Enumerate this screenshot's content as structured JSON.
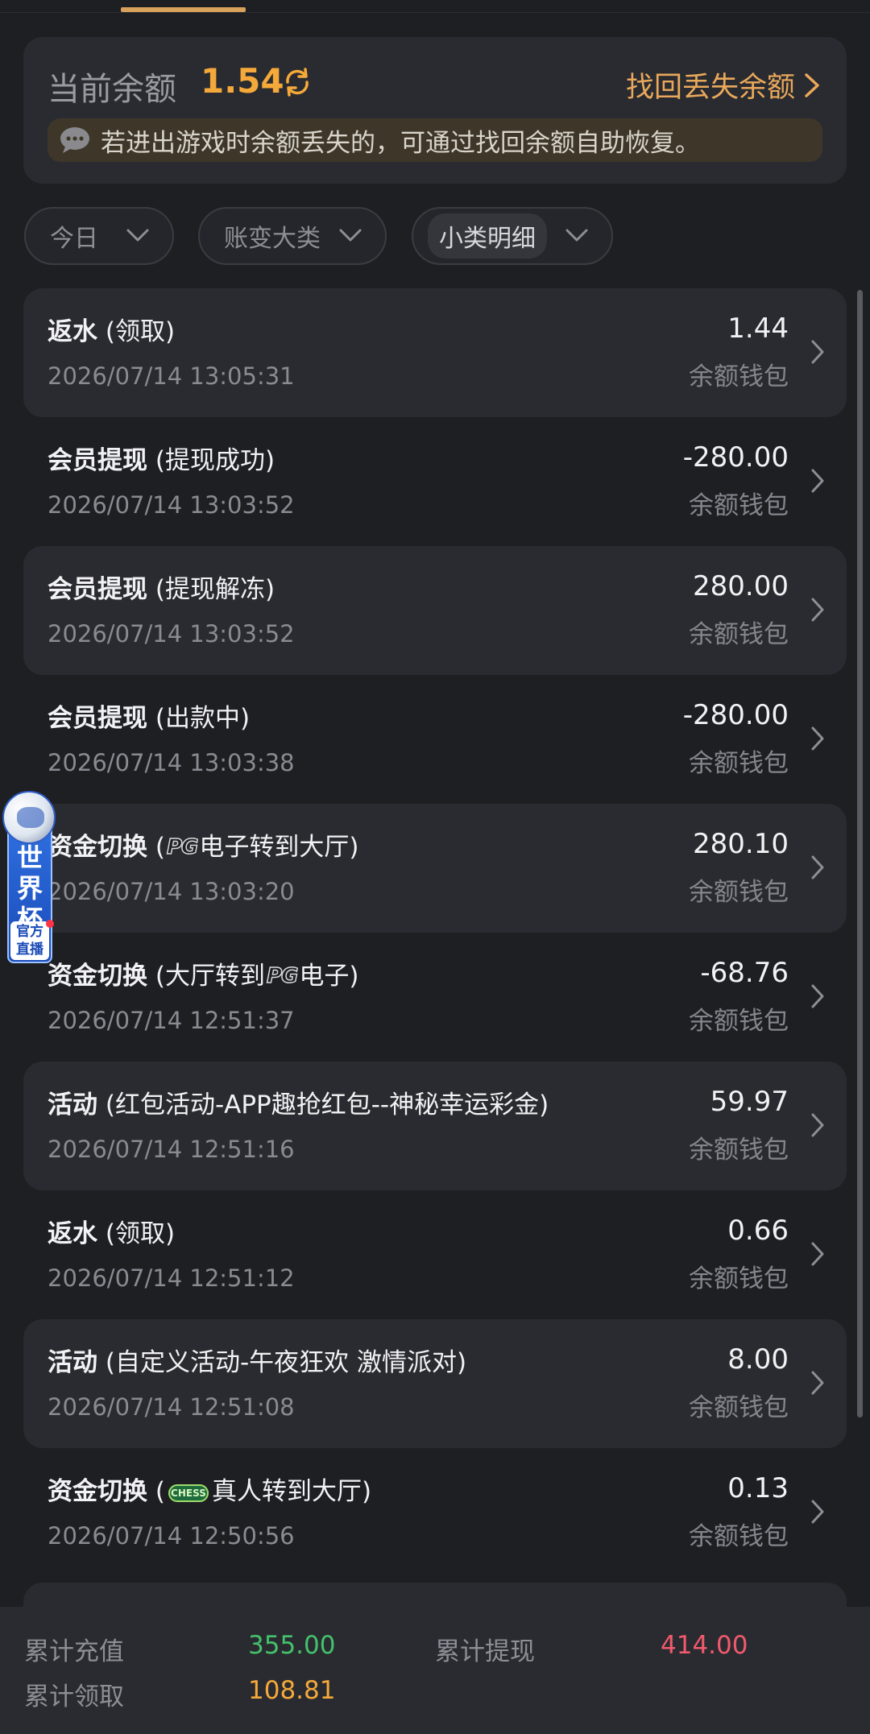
{
  "balance": {
    "label": "当前余额",
    "value": "1.54",
    "recover_label": "找回丢失余额",
    "tip": "若进出游戏时余额丢失的，可通过找回余额自助恢复。"
  },
  "filters": {
    "day": "今日",
    "category": "账变大类",
    "subcategory": "小类明细"
  },
  "records": [
    {
      "type": "返水",
      "detail_pre": " (领取)",
      "logo": "",
      "detail_post": "",
      "time": "2026/07/14 13:05:31",
      "amount": "1.44",
      "wallet": "余额钱包"
    },
    {
      "type": "会员提现",
      "detail_pre": " (提现成功)",
      "logo": "",
      "detail_post": "",
      "time": "2026/07/14 13:03:52",
      "amount": "-280.00",
      "wallet": "余额钱包"
    },
    {
      "type": "会员提现",
      "detail_pre": " (提现解冻)",
      "logo": "",
      "detail_post": "",
      "time": "2026/07/14 13:03:52",
      "amount": "280.00",
      "wallet": "余额钱包"
    },
    {
      "type": "会员提现",
      "detail_pre": " (出款中)",
      "logo": "",
      "detail_post": "",
      "time": "2026/07/14 13:03:38",
      "amount": "-280.00",
      "wallet": "余额钱包"
    },
    {
      "type": "资金切换",
      "detail_pre": " (",
      "logo": "PG",
      "detail_post": "电子转到大厅)",
      "time": "2026/07/14 13:03:20",
      "amount": "280.10",
      "wallet": "余额钱包"
    },
    {
      "type": "资金切换",
      "detail_pre": " (大厅转到",
      "logo": "PG",
      "detail_post": "电子)",
      "time": "2026/07/14 12:51:37",
      "amount": "-68.76",
      "wallet": "余额钱包"
    },
    {
      "type": "活动",
      "detail_pre": " (红包活动-APP趣抢红包--神秘幸运彩金)",
      "logo": "",
      "detail_post": "",
      "time": "2026/07/14 12:51:16",
      "amount": "59.97",
      "wallet": "余额钱包"
    },
    {
      "type": "返水",
      "detail_pre": " (领取)",
      "logo": "",
      "detail_post": "",
      "time": "2026/07/14 12:51:12",
      "amount": "0.66",
      "wallet": "余额钱包"
    },
    {
      "type": "活动",
      "detail_pre": " (自定义活动-午夜狂欢 激情派对)",
      "logo": "",
      "detail_post": "",
      "time": "2026/07/14 12:51:08",
      "amount": "8.00",
      "wallet": "余额钱包"
    },
    {
      "type": "资金切换",
      "detail_pre": " (",
      "logo": "CHESS",
      "detail_post": "真人转到大厅)",
      "time": "2026/07/14 12:50:56",
      "amount": "0.13",
      "wallet": "余额钱包"
    }
  ],
  "widget": {
    "title": "世界杯",
    "live": "官方直播"
  },
  "summary": {
    "deposit_label": "累计充值",
    "deposit_value": "355.00",
    "withdraw_label": "累计提现",
    "withdraw_value": "414.00",
    "claim_label": "累计领取",
    "claim_value": "108.81"
  },
  "colors": {
    "accent": "#f5a93a",
    "deposit": "#43c26b",
    "withdraw": "#f05a6e"
  }
}
